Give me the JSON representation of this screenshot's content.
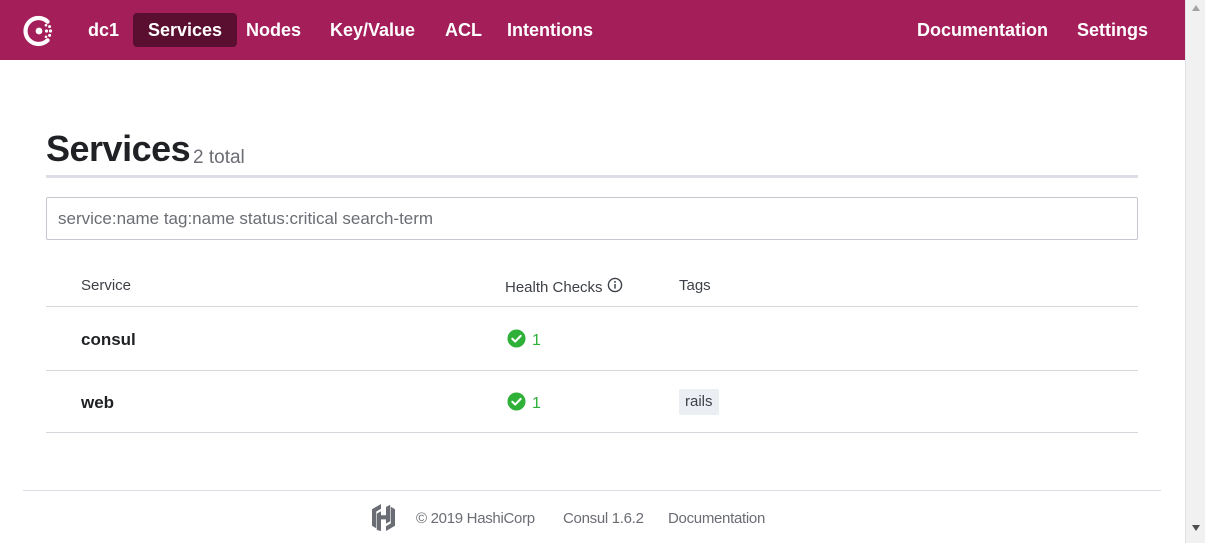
{
  "nav": {
    "datacenter": "dc1",
    "items": [
      {
        "label": "Services",
        "active": true
      },
      {
        "label": "Nodes"
      },
      {
        "label": "Key/Value"
      },
      {
        "label": "ACL"
      },
      {
        "label": "Intentions"
      }
    ],
    "right_items": [
      {
        "label": "Documentation"
      },
      {
        "label": "Settings"
      }
    ]
  },
  "header": {
    "title": "Services",
    "count": "2 total"
  },
  "search": {
    "placeholder": "service:name tag:name status:critical search-term",
    "value": ""
  },
  "table": {
    "columns": [
      "Service",
      "Health Checks",
      "Tags"
    ],
    "health_info_icon": "info-icon",
    "rows": [
      {
        "service": "consul",
        "health_checks": "1",
        "health_status": "passing",
        "tags": []
      },
      {
        "service": "web",
        "health_checks": "1",
        "health_status": "passing",
        "tags": [
          "rails"
        ]
      }
    ]
  },
  "footer": {
    "copyright": "© 2019 HashiCorp",
    "version": "Consul 1.6.2",
    "docs": "Documentation"
  },
  "colors": {
    "brand": "#a41e5a",
    "brand_active": "#5b0f30",
    "passing": "#2eb039"
  }
}
